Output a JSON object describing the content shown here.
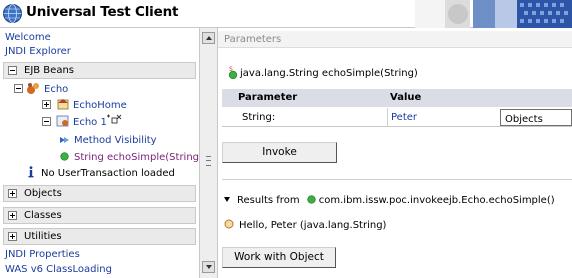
{
  "header": {
    "title": "Universal Test Client",
    "logo_icon": "ibm-globe-icon"
  },
  "nav": {
    "welcome": "Welcome",
    "jndi_explorer": "JNDI Explorer",
    "ejb_beans": "EJB Beans",
    "tree": {
      "echo": "Echo",
      "echo_home": "EchoHome",
      "echo_1": "Echo 1",
      "method_visibility": "Method Visibility",
      "method": "String echoSimple(String)",
      "no_tx": "No UserTransaction loaded"
    },
    "objects": "Objects",
    "classes": "Classes",
    "utilities": "Utilities",
    "jndi_properties": "JNDI Properties",
    "was_classloading": "WAS v6 ClassLoading"
  },
  "main": {
    "section_title": "Parameters",
    "method_signature": "java.lang.String echoSimple(String)",
    "table": {
      "col_parameter": "Parameter",
      "col_value": "Value",
      "row_param": "String:",
      "row_value": "Peter",
      "row_type": "Objects"
    },
    "invoke_label": "Invoke",
    "results_prefix": "Results from",
    "results_method": "com.ibm.issw.poc.invokeejb.Echo.echoSimple()",
    "result_text": "Hello, Peter (java.lang.String)",
    "work_with_label": "Work with Object"
  },
  "colors": {
    "link": "#1a3c9e",
    "method_purple": "#7b1e7b",
    "table_header": "#dadde6",
    "banner_blue": "#2c55a8"
  }
}
